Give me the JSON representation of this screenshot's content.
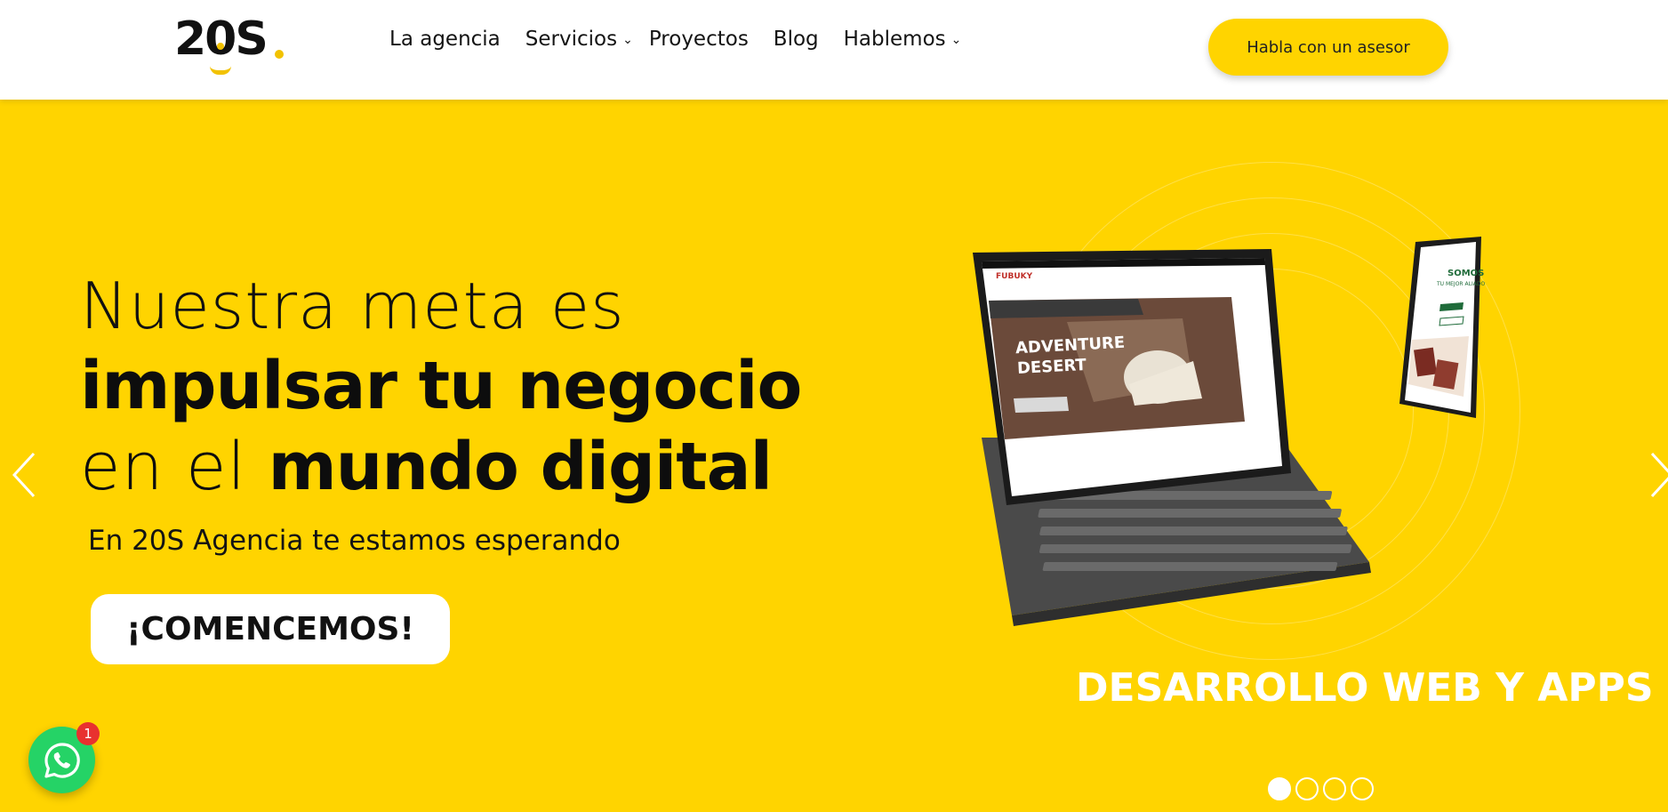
{
  "header": {
    "logo_text": "20S",
    "nav": [
      {
        "label": "La agencia"
      },
      {
        "label": "Servicios"
      },
      {
        "label": "Proyectos"
      },
      {
        "label": "Blog"
      },
      {
        "label": "Hablemos"
      }
    ],
    "cta_label": "Habla con un asesor"
  },
  "hero": {
    "line1": "Nuestra meta es",
    "line2": "impulsar tu negocio",
    "line3_light": "en el ",
    "line3_bold": "mundo digital",
    "subtitle": "En 20S Agencia te estamos esperando",
    "cta_label": "¡COMENCEMOS!",
    "slide_caption": "DESARROLLO WEB Y APPS",
    "slide_count": 4,
    "active_slide": 1
  },
  "mockup": {
    "tablet_brand": "FUBUKY",
    "tablet_headline_1": "ADVENTURE",
    "tablet_headline_2": "DESERT",
    "phone_title_1": "SOMOS",
    "phone_title_2": "TU MEJOR ALIADO"
  },
  "whatsapp": {
    "badge_count": "1"
  },
  "colors": {
    "brand_yellow": "#ffd400",
    "whatsapp_green": "#25d366",
    "badge_red": "#e8312f"
  }
}
